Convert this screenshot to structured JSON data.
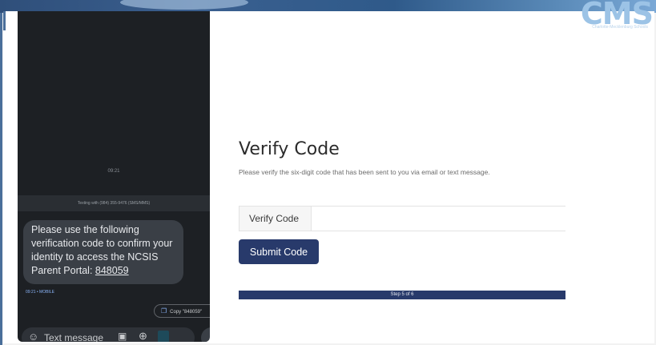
{
  "header": {
    "logo_text": "CMS",
    "logo_subtext": "Charlotte-Mecklenburg Schools"
  },
  "phone": {
    "time": "09:21",
    "texting_with": "Texting with (984) 355-9476 (SMS/MMS)",
    "message": {
      "text": "Please use the following verification code to confirm your identity to access the NCSIS Parent Portal: ",
      "code": "848059",
      "meta": "09:21 • MOBILE"
    },
    "copy_chip_label": "Copy \"848059\"",
    "compose_placeholder": "Text message"
  },
  "form": {
    "title": "Verify Code",
    "subtitle": "Please verify the six-digit code that has been sent to you via email or text message.",
    "field_label": "Verify Code",
    "field_value": "",
    "submit_label": "Submit Code"
  },
  "progress": {
    "label": "Step 5 of 6",
    "fraction": 1.0
  },
  "colors": {
    "accent": "#283a6b",
    "phone_bg": "#1d2024",
    "bubble": "#3a3f46"
  }
}
